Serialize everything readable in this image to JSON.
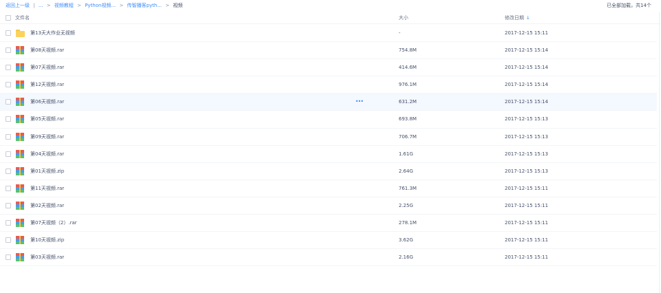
{
  "breadcrumb": {
    "items": [
      "返回上一级",
      "|",
      "...",
      ">",
      "视频教程",
      ">",
      "Python视频...",
      ">",
      "传智播客pyth...",
      ">",
      "视频"
    ],
    "back": "返回上一级",
    "bar": "|",
    "ellipsis": "...",
    "sep": ">",
    "level1": "视频教程",
    "level2": "Python视频...",
    "level3": "传智播客pyth...",
    "current": "视频"
  },
  "status": {
    "loaded_text": "已全部加载，共14个"
  },
  "columns": {
    "name": "文件名",
    "size": "大小",
    "date": "修改日期",
    "sort_arrow": "↓"
  },
  "rows": [
    {
      "name": "第13天大作业无视频",
      "size": "-",
      "date": "2017-12-15 15:11",
      "icon": "folder-icon"
    },
    {
      "name": "第08天视频.rar",
      "size": "754.8M",
      "date": "2017-12-15 15:14",
      "icon": "archive-icon"
    },
    {
      "name": "第07天视频.rar",
      "size": "414.6M",
      "date": "2017-12-15 15:14",
      "icon": "archive-icon"
    },
    {
      "name": "第12天视频.rar",
      "size": "976.1M",
      "date": "2017-12-15 15:14",
      "icon": "archive-icon"
    },
    {
      "name": "第06天视频.rar",
      "size": "631.2M",
      "date": "2017-12-15 15:14",
      "icon": "archive-icon",
      "more": "•••"
    },
    {
      "name": "第05天视频.rar",
      "size": "693.8M",
      "date": "2017-12-15 15:13",
      "icon": "archive-icon"
    },
    {
      "name": "第09天视频.rar",
      "size": "706.7M",
      "date": "2017-12-15 15:13",
      "icon": "archive-icon"
    },
    {
      "name": "第04天视频.rar",
      "size": "1.61G",
      "date": "2017-12-15 15:13",
      "icon": "archive-icon"
    },
    {
      "name": "第01天视频.zip",
      "size": "2.64G",
      "date": "2017-12-15 15:13",
      "icon": "archive-icon"
    },
    {
      "name": "第11天视频.rar",
      "size": "761.3M",
      "date": "2017-12-15 15:11",
      "icon": "archive-icon"
    },
    {
      "name": "第02天视频.rar",
      "size": "2.25G",
      "date": "2017-12-15 15:11",
      "icon": "archive-icon"
    },
    {
      "name": "第07天视频（2）.rar",
      "size": "278.1M",
      "date": "2017-12-15 15:11",
      "icon": "archive-icon"
    },
    {
      "name": "第10天视频.zip",
      "size": "3.62G",
      "date": "2017-12-15 15:11",
      "icon": "archive-icon"
    },
    {
      "name": "第03天视频.rar",
      "size": "2.16G",
      "date": "2017-12-15 15:11",
      "icon": "archive-icon"
    }
  ],
  "colors": {
    "link": "#3b8cff",
    "text": "#424e67",
    "hover_row": "#f4f8ff",
    "divider": "#f2f4f7"
  }
}
